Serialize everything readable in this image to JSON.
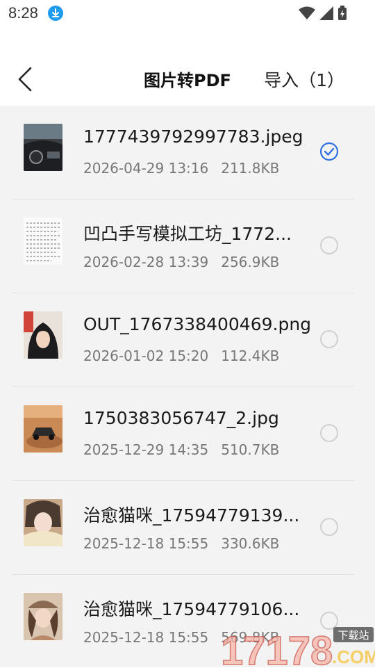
{
  "status_bar": {
    "time": "8:28"
  },
  "header": {
    "title": "图片转PDF",
    "import_label": "导入（1）"
  },
  "files": [
    {
      "name": "1777439792997783.jpeg",
      "date": "2026-04-29 13:16",
      "size": "211.8KB",
      "selected": true,
      "thumb": "car-interior"
    },
    {
      "name": "凹凸手写模拟工坊_1772...",
      "date": "2026-02-28 13:39",
      "size": "256.9KB",
      "selected": false,
      "thumb": "handwriting-page"
    },
    {
      "name": "OUT_1767338400469.png",
      "date": "2026-01-02 15:20",
      "size": "112.4KB",
      "selected": false,
      "thumb": "portrait-hood"
    },
    {
      "name": "1750383056747_2.jpg",
      "date": "2025-12-29 14:35",
      "size": "510.7KB",
      "selected": false,
      "thumb": "offroad-car"
    },
    {
      "name": "治愈猫咪_17594779139...",
      "date": "2025-12-18 15:55",
      "size": "330.6KB",
      "selected": false,
      "thumb": "portrait-scarf"
    },
    {
      "name": "治愈猫咪_17594779106...",
      "date": "2025-12-18 15:55",
      "size": "569.8KB",
      "selected": false,
      "thumb": "portrait-hat"
    }
  ],
  "watermark": {
    "text": "17178",
    "badge": "下载站",
    "suffix": ".COM"
  },
  "colors": {
    "accent": "#2f6fe0",
    "list_bg": "#f3f3f3",
    "divider": "#e2e2e2"
  }
}
